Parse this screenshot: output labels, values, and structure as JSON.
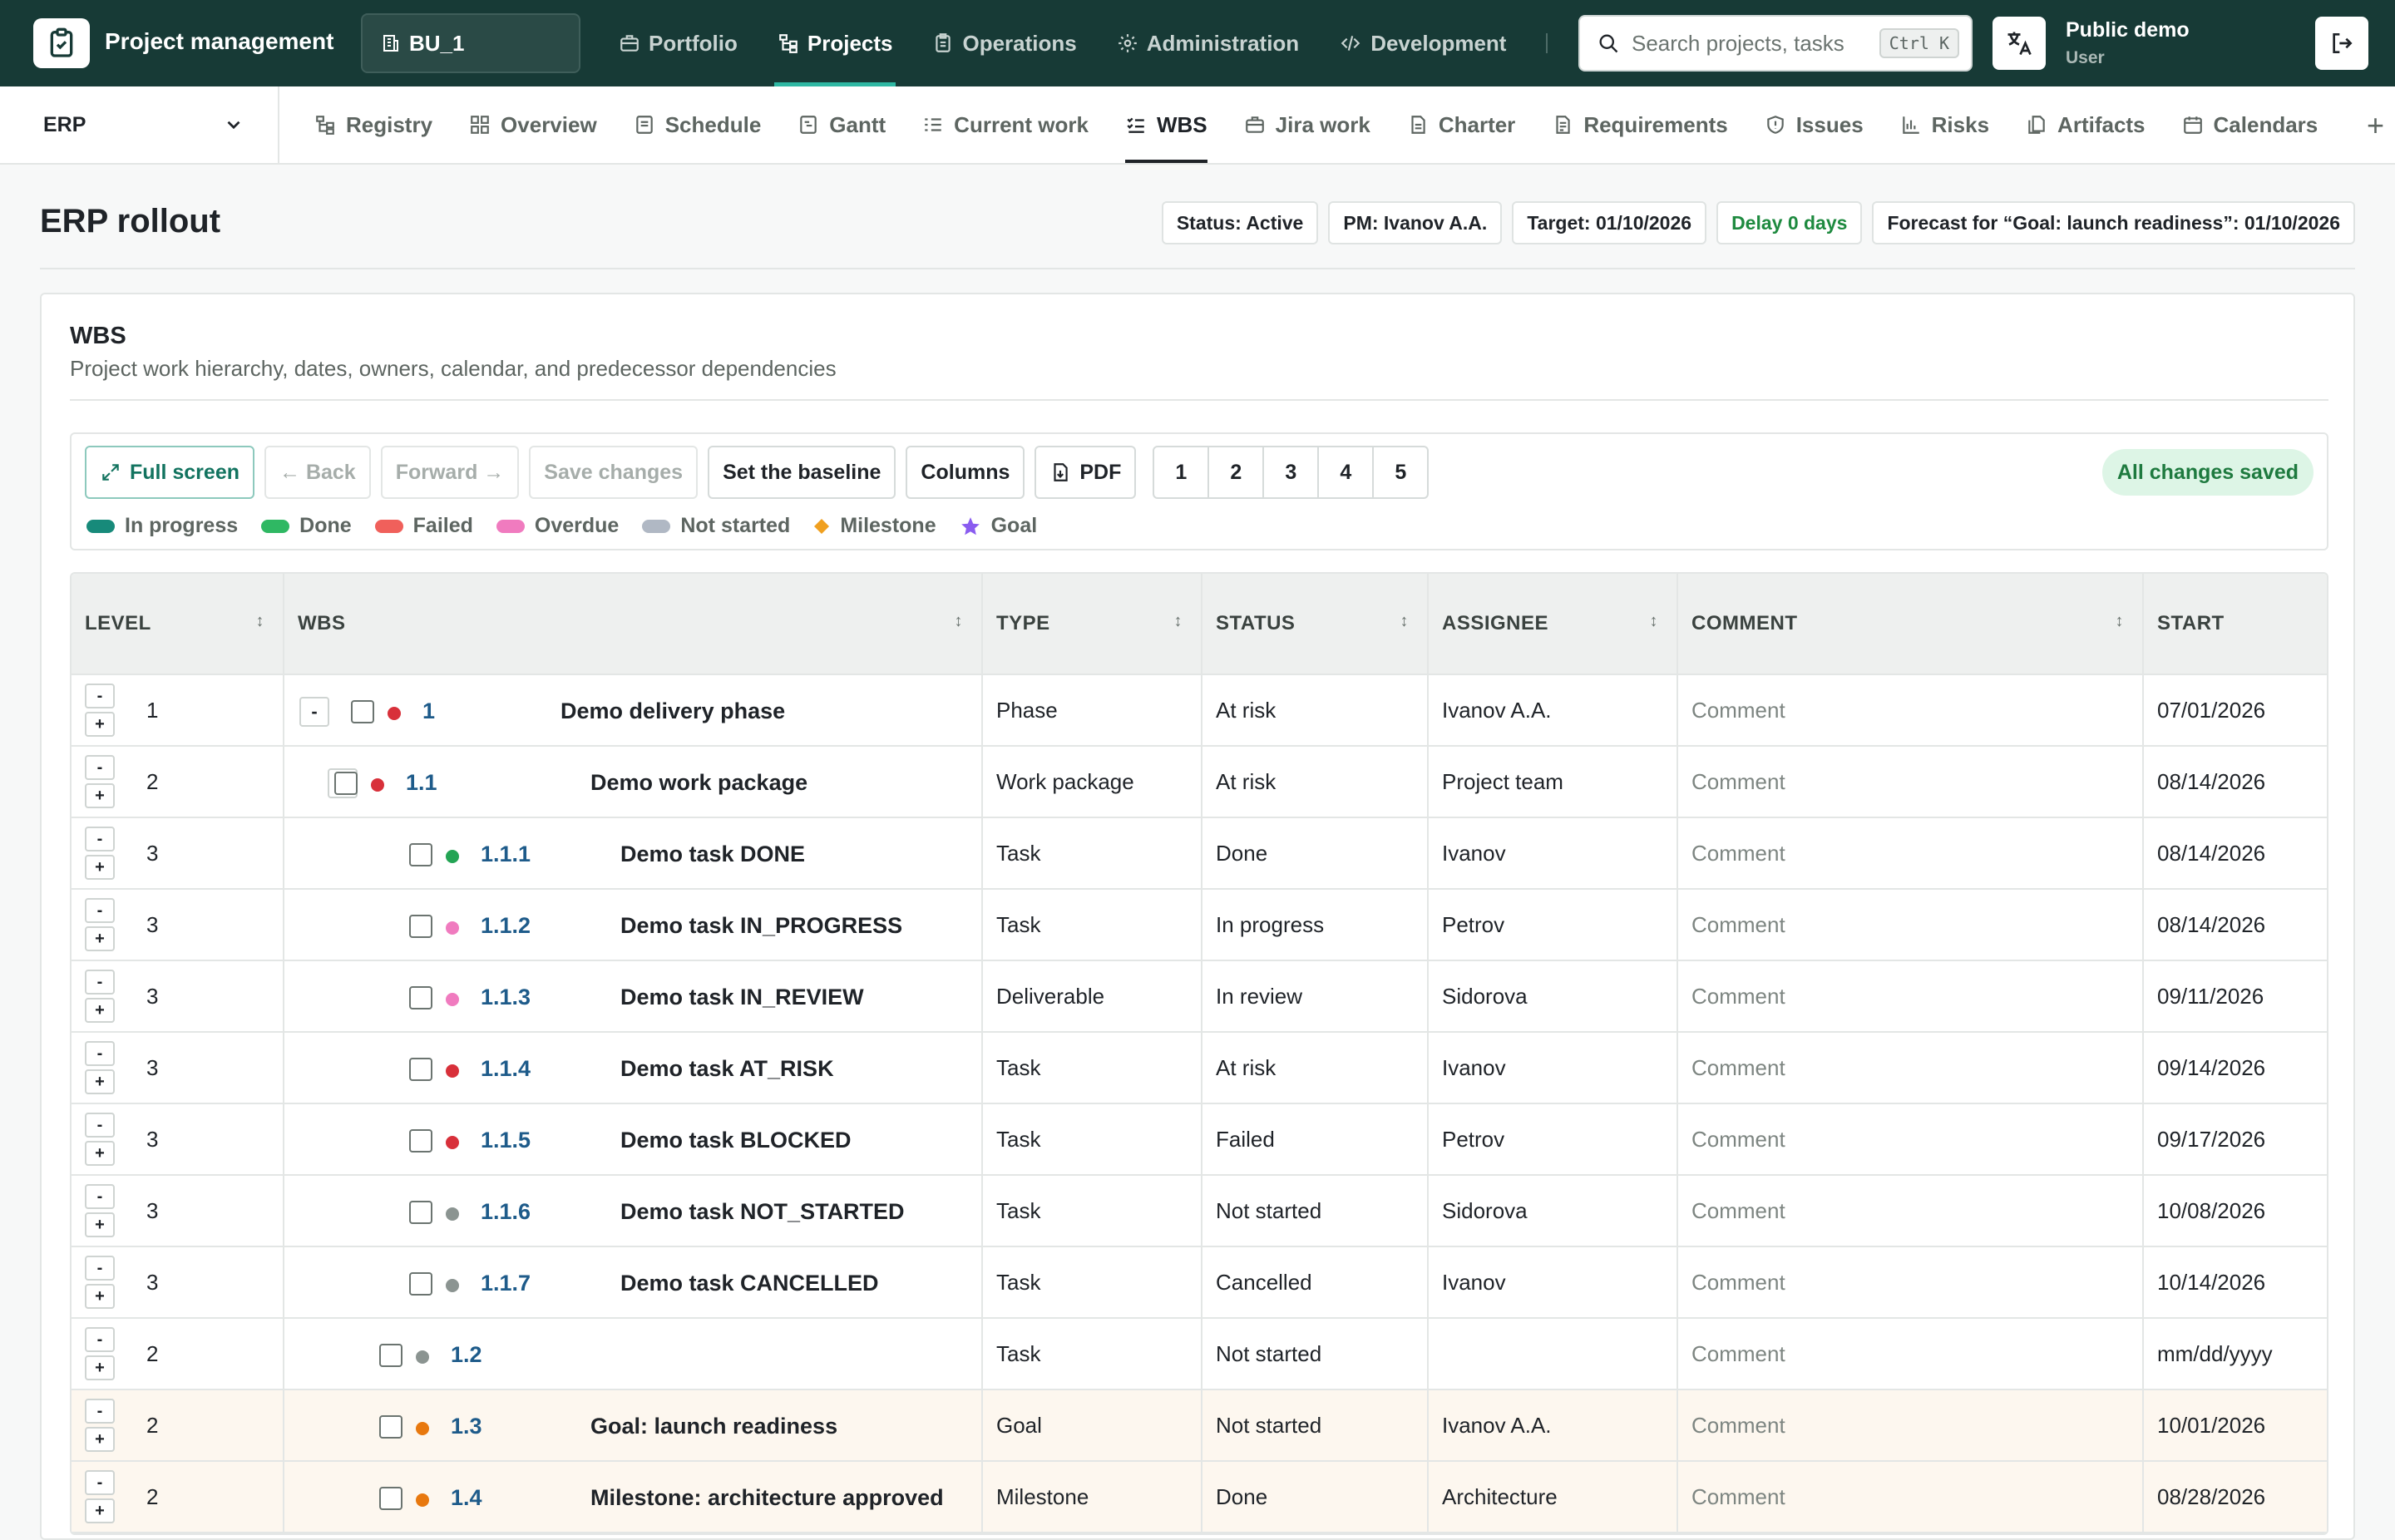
{
  "app": {
    "title": "Project management",
    "business_unit": "BU_1",
    "nav": [
      {
        "label": "Portfolio",
        "icon": "briefcase-icon"
      },
      {
        "label": "Projects",
        "icon": "hierarchy-icon",
        "active": true
      },
      {
        "label": "Operations",
        "icon": "clipboard-icon"
      },
      {
        "label": "Administration",
        "icon": "gear-icon"
      },
      {
        "label": "Development",
        "icon": "code-icon"
      }
    ],
    "search_placeholder": "Search projects, tasks",
    "search_shortcut": "Ctrl K",
    "user_name": "Public demo",
    "user_role": "User"
  },
  "subnav": {
    "project": "ERP",
    "tabs": [
      {
        "label": "Registry"
      },
      {
        "label": "Overview"
      },
      {
        "label": "Schedule"
      },
      {
        "label": "Gantt"
      },
      {
        "label": "Current work"
      },
      {
        "label": "WBS",
        "active": true
      },
      {
        "label": "Jira work"
      },
      {
        "label": "Charter"
      },
      {
        "label": "Requirements"
      },
      {
        "label": "Issues"
      },
      {
        "label": "Risks"
      },
      {
        "label": "Artifacts"
      },
      {
        "label": "Calendars"
      }
    ],
    "add_label": "+"
  },
  "page": {
    "title": "ERP rollout",
    "chips": {
      "status": "Status: Active",
      "pm": "PM: Ivanov A.A.",
      "target": "Target: 01/10/2026",
      "delay": "Delay 0 days",
      "forecast": "Forecast for “Goal: launch readiness”: 01/10/2026"
    }
  },
  "wbs": {
    "title": "WBS",
    "subtitle": "Project work hierarchy, dates, owners, calendar, and predecessor dependencies",
    "toolbar": {
      "full_screen": "Full screen",
      "back": "← Back",
      "forward": "Forward →",
      "save": "Save changes",
      "baseline": "Set the baseline",
      "columns": "Columns",
      "pdf": "PDF",
      "pages": [
        "1",
        "2",
        "3",
        "4",
        "5"
      ],
      "saved": "All changes saved"
    },
    "legend": [
      {
        "label": "In progress",
        "color": "#178a7a",
        "shape": "pill"
      },
      {
        "label": "Done",
        "color": "#2fb863",
        "shape": "pill"
      },
      {
        "label": "Failed",
        "color": "#f0605b",
        "shape": "pill"
      },
      {
        "label": "Overdue",
        "color": "#f07bbf",
        "shape": "pill"
      },
      {
        "label": "Not started",
        "color": "#b0b8c4",
        "shape": "pill"
      },
      {
        "label": "Milestone",
        "color": "#f0a020",
        "shape": "diamond"
      },
      {
        "label": "Goal",
        "color": "#8a5cf0",
        "shape": "star"
      }
    ],
    "columns": {
      "level": "LEVEL",
      "wbs": "WBS",
      "type": "TYPE",
      "status": "STATUS",
      "assignee": "ASSIGNEE",
      "comment": "COMMENT",
      "start": "START"
    },
    "rows": [
      {
        "level": "1",
        "depth": 0,
        "collapse": "-",
        "code": "1",
        "name": "Demo delivery phase",
        "dot": "#d8303a",
        "type": "Phase",
        "status": "At risk",
        "assignee": "Ivanov A.A.",
        "comment": "Comment",
        "start": "07/01/2026"
      },
      {
        "level": "2",
        "depth": 1,
        "collapse": "-",
        "code": "1.1",
        "name": "Demo work package",
        "dot": "#d8303a",
        "type": "Work package",
        "status": "At risk",
        "assignee": "Project team",
        "comment": "Comment",
        "start": "08/14/2026"
      },
      {
        "level": "3",
        "depth": 2,
        "code": "1.1.1",
        "name": "Demo task DONE",
        "dot": "#23a454",
        "type": "Task",
        "status": "Done",
        "assignee": "Ivanov",
        "comment": "Comment",
        "start": "08/14/2026"
      },
      {
        "level": "3",
        "depth": 2,
        "code": "1.1.2",
        "name": "Demo task IN_PROGRESS",
        "dot": "#f07bbf",
        "type": "Task",
        "status": "In progress",
        "assignee": "Petrov",
        "comment": "Comment",
        "start": "08/14/2026"
      },
      {
        "level": "3",
        "depth": 2,
        "code": "1.1.3",
        "name": "Demo task IN_REVIEW",
        "dot": "#f07bbf",
        "type": "Deliverable",
        "status": "In review",
        "assignee": "Sidorova",
        "comment": "Comment",
        "start": "09/11/2026"
      },
      {
        "level": "3",
        "depth": 2,
        "code": "1.1.4",
        "name": "Demo task AT_RISK",
        "dot": "#d8303a",
        "type": "Task",
        "status": "At risk",
        "assignee": "Ivanov",
        "comment": "Comment",
        "start": "09/14/2026"
      },
      {
        "level": "3",
        "depth": 2,
        "code": "1.1.5",
        "name": "Demo task BLOCKED",
        "dot": "#d8303a",
        "type": "Task",
        "status": "Failed",
        "assignee": "Petrov",
        "comment": "Comment",
        "start": "09/17/2026"
      },
      {
        "level": "3",
        "depth": 2,
        "code": "1.1.6",
        "name": "Demo task NOT_STARTED",
        "dot": "#8b9491",
        "type": "Task",
        "status": "Not started",
        "assignee": "Sidorova",
        "comment": "Comment",
        "start": "10/08/2026"
      },
      {
        "level": "3",
        "depth": 2,
        "code": "1.1.7",
        "name": "Demo task CANCELLED",
        "dot": "#8b9491",
        "type": "Task",
        "status": "Cancelled",
        "assignee": "Ivanov",
        "comment": "Comment",
        "start": "10/14/2026"
      },
      {
        "level": "2",
        "depth": 1,
        "code": "1.2",
        "name": "",
        "dot": "#8b9491",
        "type": "Task",
        "status": "Not started",
        "assignee": "",
        "comment": "Comment",
        "start": "mm/dd/yyyy"
      },
      {
        "level": "2",
        "depth": 1,
        "code": "1.3",
        "name": "Goal: launch readiness",
        "dot": "#e8780e",
        "type": "Goal",
        "status": "Not started",
        "assignee": "Ivanov A.A.",
        "comment": "Comment",
        "start": "10/01/2026",
        "highlight": true
      },
      {
        "level": "2",
        "depth": 1,
        "code": "1.4",
        "name": "Milestone: architecture approved",
        "dot": "#e8780e",
        "type": "Milestone",
        "status": "Done",
        "assignee": "Architecture",
        "comment": "Comment",
        "start": "08/28/2026",
        "highlight": true
      }
    ]
  }
}
